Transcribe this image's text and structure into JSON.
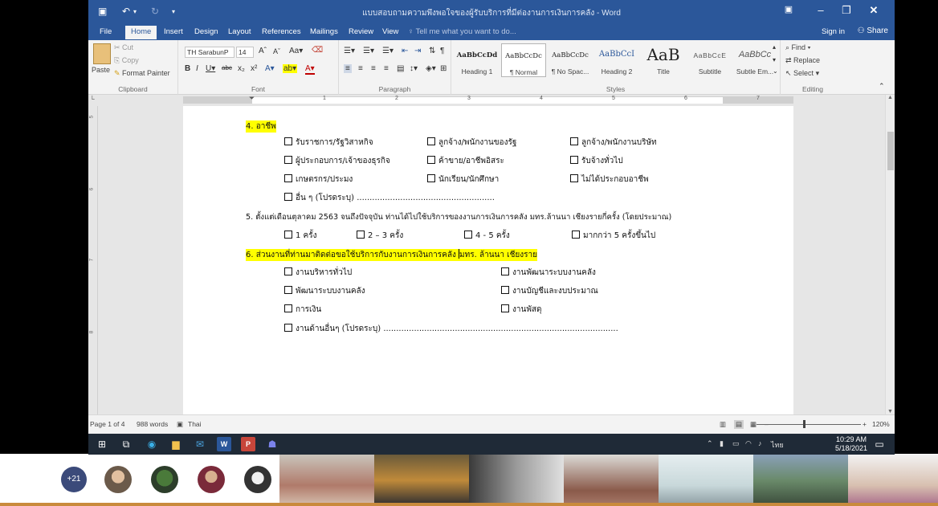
{
  "window": {
    "title": "แบบสอบถามความพึงพอใจของผู้รับบริการที่มีต่องานการเงินการคลัง - Word"
  },
  "menu": {
    "tabs": [
      "File",
      "Home",
      "Insert",
      "Design",
      "Layout",
      "References",
      "Mailings",
      "Review",
      "View"
    ],
    "active_tab": "Home",
    "tell_me": "Tell me what you want to do...",
    "sign_in": "Sign in",
    "share": "Share"
  },
  "ribbon": {
    "clipboard": {
      "cut": "Cut",
      "copy": "Copy",
      "paste": "Paste",
      "format_painter": "Format Painter",
      "label": "Clipboard"
    },
    "font": {
      "name": "TH SarabunP",
      "size": "14",
      "label": "Font"
    },
    "paragraph": {
      "label": "Paragraph"
    },
    "styles": {
      "label": "Styles",
      "items": [
        {
          "preview": "AaBbCcDd",
          "name": "Heading 1"
        },
        {
          "preview": "AaBbCcDc",
          "name": "¶ Normal"
        },
        {
          "preview": "AaBbCcDc",
          "name": "¶ No Spac..."
        },
        {
          "preview": "AaBbCcI",
          "name": "Heading 2"
        },
        {
          "preview": "AaB",
          "name": "Title"
        },
        {
          "preview": "AaBbCcE",
          "name": "Subtitle"
        },
        {
          "preview": "AaBbCc",
          "name": "Subtle Em..."
        }
      ]
    },
    "editing": {
      "find": "Find",
      "replace": "Replace",
      "select": "Select",
      "label": "Editing"
    }
  },
  "document": {
    "q4": {
      "heading": "4. อาชีพ",
      "options": [
        "รับราชการ/รัฐวิสาหกิจ",
        "ลูกจ้าง/พนักงานของรัฐ",
        "ลูกจ้าง/พนักงานบริษัท",
        "ผู้ประกอบการ/เจ้าของธุรกิจ",
        "ค้าขาย/อาชีพอิสระ",
        "รับจ้างทั่วไป",
        "เกษตรกร/ประมง",
        "นักเรียน/นักศึกษา",
        "ไม่ได้ประกอบอาชีพ"
      ],
      "other": "อื่น ๆ (โปรดระบุ) ......................................................"
    },
    "q5": {
      "heading": "5. ตั้งแต่เดือนตุลาคม 2563 จนถึงปัจจุบัน ท่านได้ไปใช้บริการของงานการเงินการคลัง มทร.ล้านนา เชียงรายกี่ครั้ง (โดยประมาณ)",
      "options": [
        "1 ครั้ง",
        "2 – 3 ครั้ง",
        "4 - 5 ครั้ง",
        "มากกว่า 5 ครั้งขึ้นไป"
      ]
    },
    "q6": {
      "heading_a": "6. ส่วนงานที่ท่านมาติดต่อขอใช้บริการกับงานการเงินการคลัง ",
      "heading_b": "มทร. ล้านนา เชียงราย",
      "options": [
        "งานบริหารทั่วไป",
        "งานพัฒนาระบบงานคลัง",
        "พัฒนาระบบงานคลัง",
        "งานบัญชีและงบประมาณ",
        "การเงิน",
        "งานพัสดุ"
      ],
      "other": "งานด้านอื่นๆ (โปรดระบุ) ............................................................................................"
    }
  },
  "status": {
    "page": "Page 1 of 4",
    "words": "988 words",
    "language": "Thai",
    "zoom": "120%"
  },
  "taskbar": {
    "lang": "ไทย",
    "time": "10:29 AM",
    "date": "5/18/2021"
  },
  "meeting": {
    "participants_more": "+21"
  },
  "colors": {
    "word_blue": "#2b579a",
    "highlight": "#ffff00"
  }
}
